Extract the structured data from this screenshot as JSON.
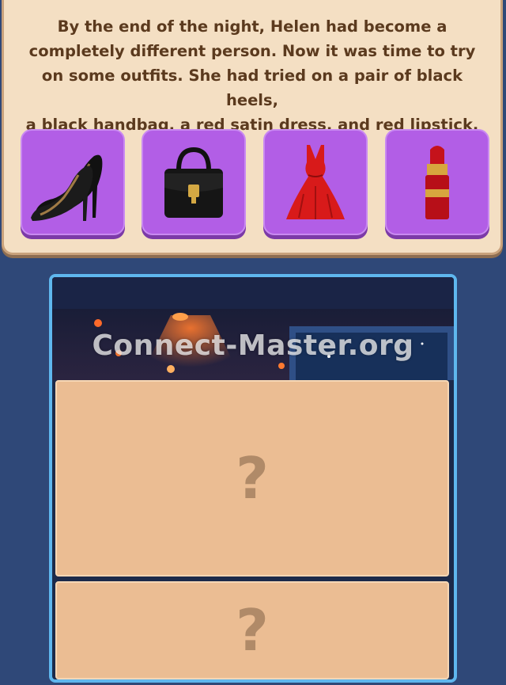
{
  "story": {
    "lines": [
      "By the end of the night, Helen had become a",
      "completely different person. Now it was time to try",
      "on some outfits. She had tried on a pair of black heels,",
      "a black handbag, a red satin dress, and red lipstick."
    ]
  },
  "items": [
    {
      "icon": "black-heels-icon"
    },
    {
      "icon": "black-handbag-icon"
    },
    {
      "icon": "red-dress-icon"
    },
    {
      "icon": "red-lipstick-icon"
    }
  ],
  "scene": {
    "watermark": "Connect-Master.org"
  },
  "slots": [
    {
      "label": "?"
    },
    {
      "label": "?"
    }
  ],
  "colors": {
    "background": "#2f4878",
    "panel": "#f4dfc3",
    "tile": "#b25ee6",
    "frame": "#5fb7ee",
    "slot": "#ebbd93"
  }
}
